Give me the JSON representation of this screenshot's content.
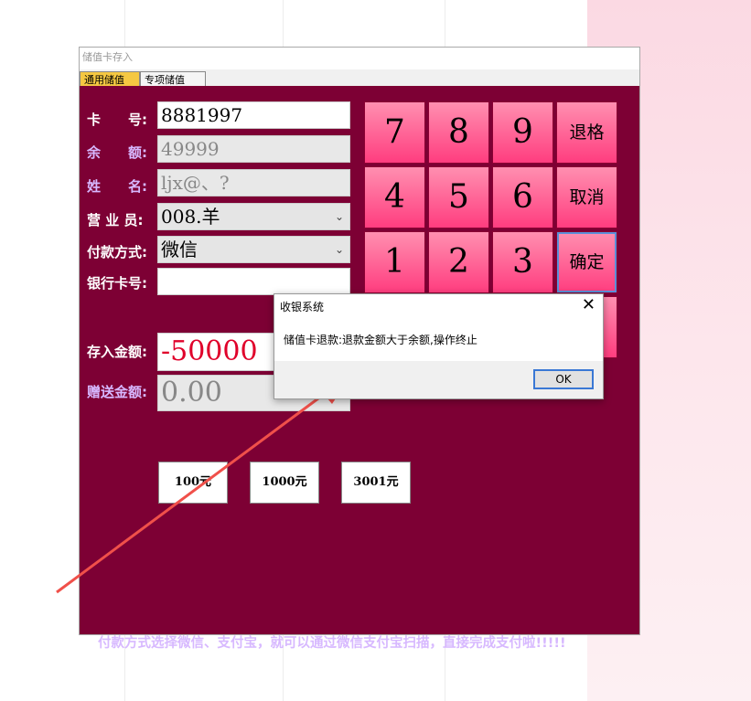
{
  "window": {
    "title": "储值卡存入"
  },
  "tabs": [
    {
      "label": "通用储值"
    },
    {
      "label": "专项储值"
    }
  ],
  "form": {
    "card_label": "卡　　号:",
    "card_value": "8881997",
    "balance_label": "余　　额:",
    "balance_value": "49999",
    "name_label": "姓　　名:",
    "name_value": "ljx@、?",
    "clerk_label": "营 业 员:",
    "clerk_value": "008.羊",
    "payment_label": "付款方式:",
    "payment_value": "微信",
    "bank_label": "银行卡号:",
    "bank_value": "",
    "deposit_label": "存入金额:",
    "deposit_value": "-50000",
    "bonus_label": "赠送金额:",
    "bonus_value": "0.00"
  },
  "keypad": {
    "k7": "7",
    "k8": "8",
    "k9": "9",
    "back": "退格",
    "k4": "4",
    "k5": "5",
    "k6": "6",
    "cancel": "取消",
    "k1": "1",
    "k2": "2",
    "k3": "3",
    "confirm": "确定"
  },
  "quick_amounts": [
    "100元",
    "1000元",
    "3001元"
  ],
  "tip": "付款方式选择微信、支付宝，就可以通过微信支付宝扫描，直接完成支付啦!!!!!",
  "dialog": {
    "title": "收银系统",
    "message": "储值卡退款:退款金额大于余额,操作终止",
    "ok_label": "OK",
    "close_glyph": "✕"
  },
  "colors": {
    "panel": "#7d0034",
    "key_top": "#ff8fb0",
    "key_bottom": "#ff3d7f",
    "deposit_text": "#e0002a",
    "arrow": "#f0504a"
  }
}
